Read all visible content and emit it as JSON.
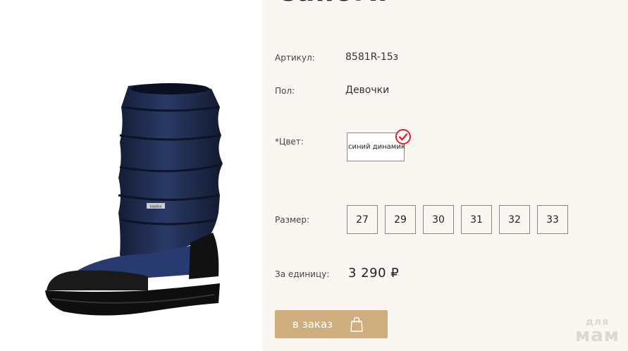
{
  "product": {
    "title_partial": "Сапоги",
    "article_label": "Артикул:",
    "article_value": "8581R-15з",
    "gender_label": "Пол:",
    "gender_value": "Девочки",
    "color_label": "*Цвет:",
    "color_value": "синий динамик",
    "size_label": "Размер:",
    "sizes": [
      "27",
      "29",
      "30",
      "31",
      "32",
      "33"
    ],
    "price_label": "За единицу:",
    "price_value": "3 290 ₽",
    "order_button_label": "в заказ",
    "image_badge": "kapika"
  },
  "watermark": {
    "line1": "для",
    "line2": "мам"
  },
  "colors": {
    "accent": "#cfae7e",
    "panel_bg": "#faf7f2",
    "check_red": "#e0202a",
    "boot_navy": "#1d2a4a"
  },
  "icons": {
    "check": "check-circle-icon",
    "bag": "shopping-bag-icon"
  }
}
